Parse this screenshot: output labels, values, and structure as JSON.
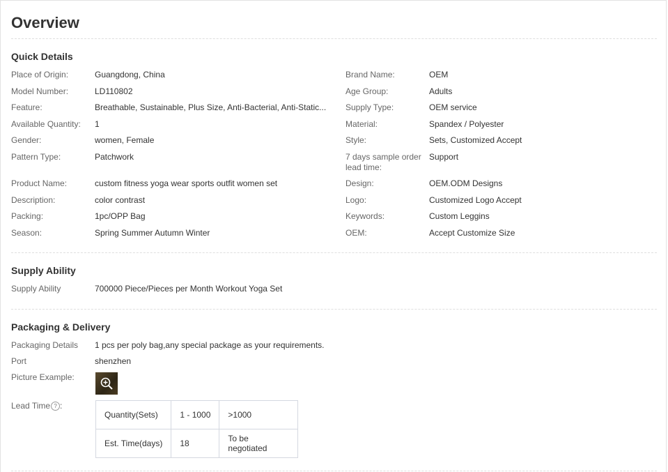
{
  "overview": {
    "title": "Overview"
  },
  "quick_details": {
    "heading": "Quick Details",
    "left": [
      {
        "label": "Place of Origin:",
        "value": "Guangdong, China"
      },
      {
        "label": "Model Number:",
        "value": "LD110802"
      },
      {
        "label": "Feature:",
        "value": "Breathable, Sustainable, Plus Size, Anti-Bacterial, Anti-Static..."
      },
      {
        "label": "Available Quantity:",
        "value": "1"
      },
      {
        "label": "Gender:",
        "value": "women, Female"
      },
      {
        "label": "Pattern Type:",
        "value": "Patchwork"
      },
      {
        "label": "Product Name:",
        "value": "custom fitness yoga wear sports outfit women set"
      },
      {
        "label": "Description:",
        "value": "color contrast"
      },
      {
        "label": "Packing:",
        "value": "1pc/OPP Bag"
      },
      {
        "label": "Season:",
        "value": "Spring Summer Autumn Winter"
      }
    ],
    "right": [
      {
        "label": "Brand Name:",
        "value": "OEM"
      },
      {
        "label": "Age Group:",
        "value": "Adults"
      },
      {
        "label": "Supply Type:",
        "value": "OEM service"
      },
      {
        "label": "Material:",
        "value": "Spandex / Polyester"
      },
      {
        "label": "Style:",
        "value": "Sets, Customized Accept"
      },
      {
        "label": "7 days sample order lead time:",
        "value": "Support"
      },
      {
        "label": "Design:",
        "value": "OEM.ODM Designs"
      },
      {
        "label": "Logo:",
        "value": "Customized Logo Accept"
      },
      {
        "label": "Keywords:",
        "value": "Custom Leggins"
      },
      {
        "label": "OEM:",
        "value": "Accept Customize Size"
      }
    ]
  },
  "supply_ability": {
    "heading": "Supply Ability",
    "label": "Supply Ability",
    "value": "700000 Piece/Pieces per Month Workout Yoga Set"
  },
  "packaging": {
    "heading": "Packaging & Delivery",
    "details_label": "Packaging Details",
    "details_value": "1 pcs per poly bag,any special package as your requirements.",
    "port_label": "Port",
    "port_value": "shenzhen",
    "picture_label": "Picture Example:",
    "lead_time_label": "Lead Time",
    "lead_time_suffix": ":",
    "help_glyph": "?",
    "lead_table": {
      "row1": [
        "Quantity(Sets)",
        "1 - 1000",
        ">1000"
      ],
      "row2": [
        "Est. Time(days)",
        "18",
        "To be negotiated"
      ]
    }
  },
  "icons": {
    "zoom": "zoom-in-icon",
    "help": "help-circle-icon"
  }
}
